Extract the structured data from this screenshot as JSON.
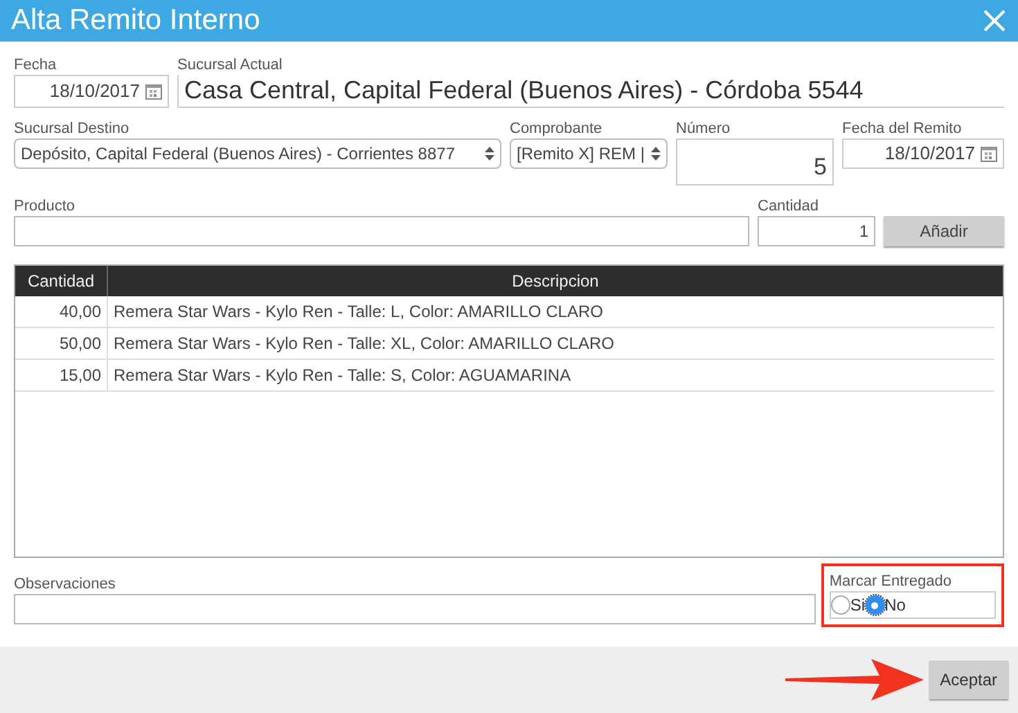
{
  "window": {
    "title": "Alta Remito Interno"
  },
  "fecha": {
    "label": "Fecha",
    "value": "18/10/2017"
  },
  "sucursal_actual": {
    "label": "Sucursal Actual",
    "value": "Casa Central, Capital Federal (Buenos Aires) - Córdoba 5544"
  },
  "sucursal_destino": {
    "label": "Sucursal Destino",
    "value": "Depósito, Capital Federal (Buenos Aires) - Corrientes 8877"
  },
  "comprobante": {
    "label": "Comprobante",
    "value": "[Remito X] REM |"
  },
  "numero": {
    "label": "Número",
    "value": "5"
  },
  "fecha_remito": {
    "label": "Fecha del Remito",
    "value": "18/10/2017"
  },
  "producto": {
    "label": "Producto"
  },
  "cantidad": {
    "label": "Cantidad",
    "value": "1"
  },
  "add_button": "Añadir",
  "table": {
    "columns": [
      "Cantidad",
      "Descripcion"
    ],
    "rows": [
      [
        "40,00",
        "Remera Star Wars - Kylo Ren - Talle: L, Color: AMARILLO CLARO"
      ],
      [
        "50,00",
        "Remera Star Wars - Kylo Ren - Talle: XL, Color: AMARILLO CLARO"
      ],
      [
        "15,00",
        "Remera Star Wars - Kylo Ren - Talle: S, Color: AGUAMARINA"
      ]
    ]
  },
  "observaciones": {
    "label": "Observaciones"
  },
  "marcar_entregado": {
    "label": "Marcar Entregado",
    "options": [
      {
        "label": "Si",
        "selected": false
      },
      {
        "label": "No",
        "selected": true
      }
    ]
  },
  "accept_button": "Aceptar"
}
